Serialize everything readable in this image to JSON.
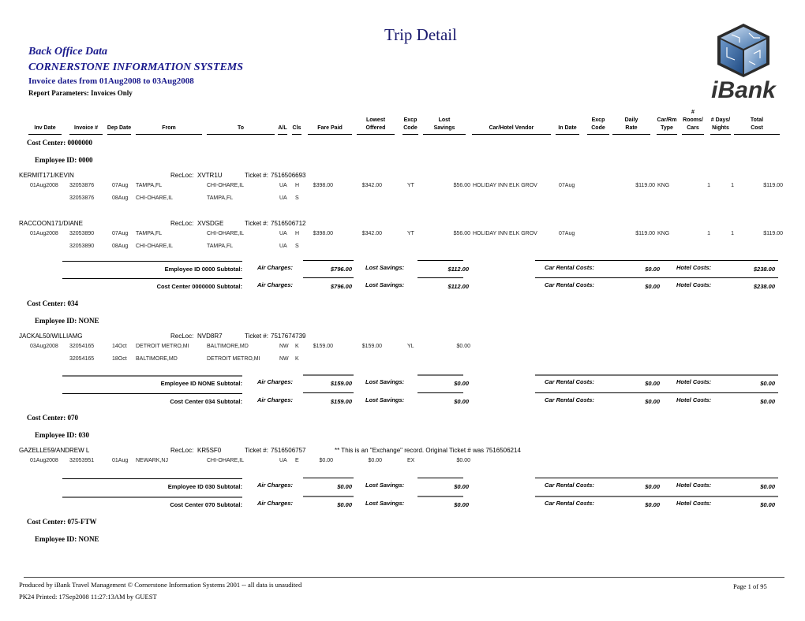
{
  "report": {
    "title": "Trip Detail",
    "source": "Back Office Data",
    "company": "CORNERSTONE INFORMATION SYSTEMS",
    "date_range": "Invoice dates from 01Aug2008 to 03Aug2008",
    "parameters": "Report Parameters: Invoices Only",
    "logo_text": "iBank"
  },
  "columns": [
    {
      "line1": "",
      "line2": "Inv Date"
    },
    {
      "line1": "",
      "line2": "Invoice #"
    },
    {
      "line1": "",
      "line2": "Dep Date"
    },
    {
      "line1": "",
      "line2": "From"
    },
    {
      "line1": "",
      "line2": "To"
    },
    {
      "line1": "",
      "line2": "A/L"
    },
    {
      "line1": "",
      "line2": "Cls"
    },
    {
      "line1": "",
      "line2": "Fare Paid"
    },
    {
      "line1": "Lowest",
      "line2": "Offered"
    },
    {
      "line1": "Excp",
      "line2": "Code"
    },
    {
      "line1": "Lost",
      "line2": "Savings"
    },
    {
      "line1": "",
      "line2": "Car/Hotel Vendor"
    },
    {
      "line1": "",
      "line2": "In Date"
    },
    {
      "line1": "Excp",
      "line2": "Code"
    },
    {
      "line1": "Daily",
      "line2": "Rate"
    },
    {
      "line1": "Car/Rm",
      "line2": "Type"
    },
    {
      "line0": "#",
      "line1": "Rooms/",
      "line2": "Cars"
    },
    {
      "line1": "# Days/",
      "line2": "Nights"
    },
    {
      "line1": "Total",
      "line2": "Cost"
    }
  ],
  "labels": {
    "recloc": "RecLoc:",
    "ticket": "Ticket #:",
    "air_charges": "Air Charges:",
    "lost_savings": "Lost Savings:",
    "car_rental": "Car Rental Costs:",
    "hotel_costs": "Hotel Costs:"
  },
  "sections": [
    {
      "cost_center": "Cost Center: 0000000",
      "employee": "Employee ID: 0000",
      "travelers": [
        {
          "name": "KERMIT171/KEVIN",
          "recloc": "XVTR1U",
          "ticket": "7516506693",
          "rows": [
            {
              "inv_date": "01Aug2008",
              "invoice": "32053876",
              "dep_date": "07Aug",
              "from": "TAMPA,FL",
              "to": "CHI-OHARE,IL",
              "al": "UA",
              "cls": "H",
              "fare": "$398.00",
              "lowest": "$342.00",
              "excp": "YT",
              "lost": "$56.00",
              "vendor": "HOLIDAY INN ELK GROV",
              "in_date": "07Aug",
              "excp2": "",
              "rate": "$119.00",
              "type": "KNG",
              "rooms": "1",
              "nights": "1",
              "total": "$119.00"
            },
            {
              "inv_date": "",
              "invoice": "32053876",
              "dep_date": "08Aug",
              "from": "CHI-OHARE,IL",
              "to": "TAMPA,FL",
              "al": "UA",
              "cls": "S"
            }
          ]
        },
        {
          "name": "RACCOON171/DIANE",
          "recloc": "XVSDGE",
          "ticket": "7516506712",
          "rows": [
            {
              "inv_date": "01Aug2008",
              "invoice": "32053890",
              "dep_date": "07Aug",
              "from": "TAMPA,FL",
              "to": "CHI-OHARE,IL",
              "al": "UA",
              "cls": "H",
              "fare": "$398.00",
              "lowest": "$342.00",
              "excp": "YT",
              "lost": "$56.00",
              "vendor": "HOLIDAY INN ELK GROV",
              "in_date": "07Aug",
              "excp2": "",
              "rate": "$119.00",
              "type": "KNG",
              "rooms": "1",
              "nights": "1",
              "total": "$119.00"
            },
            {
              "inv_date": "",
              "invoice": "32053890",
              "dep_date": "08Aug",
              "from": "CHI-OHARE,IL",
              "to": "TAMPA,FL",
              "al": "UA",
              "cls": "S"
            }
          ]
        }
      ],
      "emp_subtotal": {
        "label": "Employee ID 0000 Subtotal:",
        "air": "$796.00",
        "lost": "$112.00",
        "car": "$0.00",
        "hotel": "$238.00"
      },
      "cc_subtotal": {
        "label": "Cost Center 0000000 Subtotal:",
        "air": "$796.00",
        "lost": "$112.00",
        "car": "$0.00",
        "hotel": "$238.00"
      }
    },
    {
      "cost_center": "Cost Center: 034",
      "employee": "Employee ID: NONE",
      "travelers": [
        {
          "name": "JACKAL50/WILLIAMG",
          "recloc": "NVD8R7",
          "ticket": "7517674739",
          "rows": [
            {
              "inv_date": "03Aug2008",
              "invoice": "32054165",
              "dep_date": "14Oct",
              "from": "DETROIT METRO,MI",
              "to": "BALTIMORE,MD",
              "al": "NW",
              "cls": "K",
              "fare": "$159.00",
              "lowest": "$159.00",
              "excp": "YL",
              "lost": "$0.00"
            },
            {
              "inv_date": "",
              "invoice": "32054165",
              "dep_date": "18Oct",
              "from": "BALTIMORE,MD",
              "to": "DETROIT METRO,MI",
              "al": "NW",
              "cls": "K"
            }
          ]
        }
      ],
      "emp_subtotal": {
        "label": "Employee ID NONE Subtotal:",
        "air": "$159.00",
        "lost": "$0.00",
        "car": "$0.00",
        "hotel": "$0.00"
      },
      "cc_subtotal": {
        "label": "Cost Center 034 Subtotal:",
        "air": "$159.00",
        "lost": "$0.00",
        "car": "$0.00",
        "hotel": "$0.00"
      }
    },
    {
      "cost_center": "Cost Center: 070",
      "employee": "Employee ID: 030",
      "travelers": [
        {
          "name": "GAZELLE59/ANDREW L",
          "recloc": "KR5SF0",
          "ticket": "7516506757",
          "note": "** This is an \"Exchange\" record.  Original Ticket # was 7516506214",
          "rows": [
            {
              "inv_date": "01Aug2008",
              "invoice": "32053951",
              "dep_date": "01Aug",
              "from": "NEWARK,NJ",
              "to": "CHI-OHARE,IL",
              "al": "UA",
              "cls": "E",
              "fare": "$0.00",
              "lowest": "$0.00",
              "excp": "EX",
              "lost": "$0.00"
            }
          ]
        }
      ],
      "emp_subtotal": {
        "label": "Employee ID 030 Subtotal:",
        "air": "$0.00",
        "lost": "$0.00",
        "car": "$0.00",
        "hotel": "$0.00"
      },
      "cc_subtotal": {
        "label": "Cost Center 070 Subtotal:",
        "air": "$0.00",
        "lost": "$0.00",
        "car": "$0.00",
        "hotel": "$0.00"
      }
    },
    {
      "cost_center": "Cost Center: 075-FTW",
      "employee": "Employee ID: NONE"
    }
  ],
  "footer": {
    "produced_by": "Produced by iBank Travel Management © Cornerstone Information Systems 2001 -- all data is unaudited",
    "printed": "PK24  Printed: 17Sep2008 11:27:13AM by GUEST",
    "page": "Page 1 of 95"
  }
}
